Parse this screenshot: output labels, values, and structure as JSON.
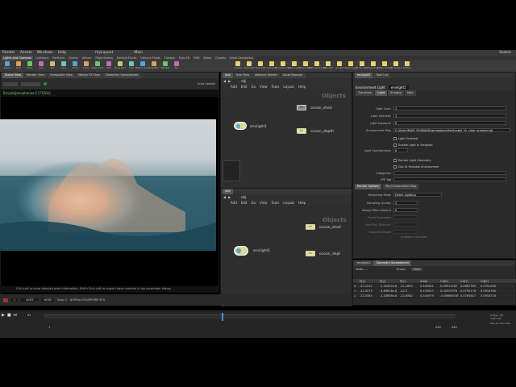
{
  "top_left_menu": [
    "Render",
    "Assets",
    "Windows",
    "Help"
  ],
  "desktop_label": "myLayout",
  "main_label": "Main",
  "top_right_label": "Solaris",
  "shelf_tabs": [
    "Lights and Cameras",
    "Collisions",
    "Particles",
    "Grains",
    "Vellum",
    "Rigid Bodies",
    "Particle Fluids",
    "Viscous Fluids",
    "Oceans",
    "Pyro FX",
    "FEM",
    "Wires",
    "Crowds",
    "Drive Simulation"
  ],
  "left_tools": [
    "Sphere",
    "Tube",
    "Torus",
    "Grid",
    "Null",
    "Line",
    "Circle",
    "Curve",
    "Draw Curve",
    "Path",
    "Spray Paint",
    "Font",
    "Platonic Solids",
    "L-System",
    "Metaball",
    "File"
  ],
  "right_tools": [
    "Camera",
    "Point Light",
    "Spot Light",
    "Area Light",
    "Geometry Light",
    "Volume Light",
    "Distant Light",
    "Environment Light",
    "Sky Light",
    "GI Light",
    "Caustic Light",
    "Portal Light",
    "Ambient Light",
    "Stereo Camera",
    "VR Camera",
    "Switcher"
  ],
  "viewport": {
    "path_label": "Env|obj|envphonos:2 [?320x]",
    "status_hint": "Ctrl+Left to show detailed pixel information. Shift+Ctrl+Left to inspect base material in the parameter dialog."
  },
  "network_top": {
    "path": "obj",
    "menu": [
      "Add",
      "Edit",
      "Go",
      "View",
      "Tools",
      "Layout",
      "Help"
    ],
    "context_label": "Objects",
    "nodes": {
      "ocean_shad": "ocean_shad",
      "ocean_depth": "ocean_depth",
      "envlight": "envlight1"
    }
  },
  "network_bottom": {
    "path": "obj",
    "menu": [
      "Add",
      "Edit",
      "Go",
      "View",
      "Tools",
      "Layout",
      "Help"
    ],
    "context_label": "Objects",
    "nodes": {
      "ocean_shad": "ocean_shad",
      "ocean_depth": "ocean_dept",
      "envlight": "envlight1"
    }
  },
  "parameters": {
    "header_type": "Environment Light",
    "header_name": "envlight1",
    "tabs": [
      "Transform",
      "Light",
      "Shadow",
      "Misc"
    ],
    "rows": [
      {
        "label": "Light Color",
        "value": "1"
      },
      {
        "label": "Light Intensity",
        "value": "1"
      },
      {
        "label": "Light Exposure",
        "value": "0"
      },
      {
        "label": "Environment Map",
        "value": "C:/Users/MARI_ROMAN/Downloads/sylterSunset_1k_clear_puresky.hdr"
      },
      {
        "label": "Light Enabled",
        "value": "Light Enabled"
      },
      {
        "label": "Enable Light In Viewport",
        "value": "Enable Light In Viewport"
      },
      {
        "label": "Light Contributions",
        "value": "0"
      },
      {
        "label": "Render Light Geometry",
        "value": "Render Light Geometry"
      },
      {
        "label": "Clip To Portable Environment",
        "value": "Clip To Portable Environment"
      },
      {
        "label": "Categories",
        "value": ""
      },
      {
        "label": "LPE Tag",
        "value": ""
      }
    ],
    "sub_tabs": [
      "Render Options",
      "Sky Environment Map"
    ],
    "render_rows": [
      {
        "label": "Rendering Mode",
        "value": "Direct Lighting"
      },
      {
        "label": "Sampling Quality",
        "value": "1"
      },
      {
        "label": "Glossy Filter Amount",
        "value": "0"
      },
      {
        "label": "Portal Geometry",
        "value": ""
      },
      {
        "label": "Max Ray Distance",
        "value": ""
      },
      {
        "label": "Sampling Angle",
        "value": ""
      }
    ],
    "ambient_label": "Ambient Occlusion"
  },
  "spreadsheet": {
    "tabs": [
      "envlight1",
      "Geometry Spreadsheet"
    ],
    "node_label": "Node: ...",
    "group_label": "Group:",
    "view_label": "View",
    "columns": [
      "",
      "P[x]",
      "P[y]",
      "P[z]",
      "mask",
      "Cd[0]",
      "Cd[1]",
      "Cd[2]"
    ],
    "rows": [
      [
        "0",
        "-22.1512",
        "-1.30452e-8",
        "-22.1655",
        "0.400442",
        "0.00911052",
        "0.0667789",
        "0.0791946"
      ],
      [
        "1",
        "-22.5573",
        "-4.69816e-8",
        "-22.5",
        "0.570053",
        "0.00333576",
        "0.0735178",
        "0.0934765"
      ],
      [
        "2",
        "-22.5354",
        "-1.18856e-8",
        "-22.8562",
        "0.344979",
        "-0.00669478",
        "0.0784547",
        "0.0918716"
      ]
    ]
  },
  "timeline": {
    "frame": "1",
    "start": "1",
    "end": "240",
    "current": "64",
    "range_end": "240",
    "render_path": "$HIP/ipr/SSAMPHIRE.$F4",
    "acs_label": "ACES",
    "srgb_label": "sRGB",
    "snap_label": "Snap 2",
    "auto_update": "Auto Update",
    "keys_label": "0 keys, 0/0 channels",
    "key_all_label": "Key All Channels"
  }
}
